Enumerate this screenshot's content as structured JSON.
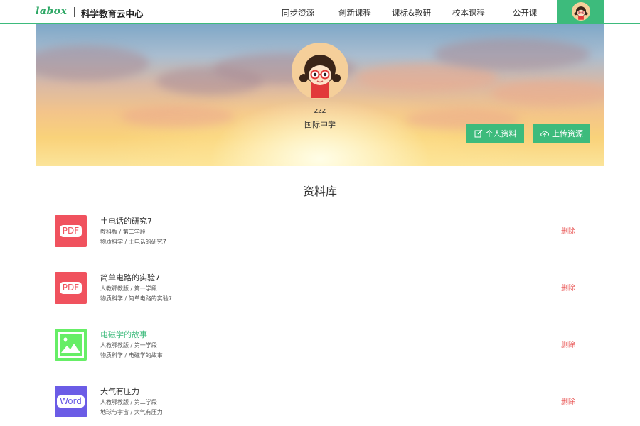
{
  "header": {
    "logo": "labox",
    "title": "科学教育云中心",
    "nav": [
      "同步资源",
      "创新课程",
      "课标&教研",
      "校本课程",
      "公开课"
    ]
  },
  "profile": {
    "name": "zzz",
    "school": "国际中学",
    "profile_button": "个人资料",
    "upload_button": "上传资源"
  },
  "library": {
    "title": "资料库",
    "delete_label": "删除",
    "items": [
      {
        "type": "PDF",
        "title": "土电话的研究7",
        "meta1": "教科版 / 第二学段",
        "meta2": "物质科学 / 土电话的研究7"
      },
      {
        "type": "PDF",
        "title": "简单电路的实验7",
        "meta1": "人教鄂教版 / 第一学段",
        "meta2": "物质科学 / 简单电路的实验7"
      },
      {
        "type": "image",
        "title": "电磁学的故事",
        "meta1": "人教鄂教版 / 第一学段",
        "meta2": "物质科学 / 电磁学的故事"
      },
      {
        "type": "Word",
        "title": "大气有压力",
        "meta1": "人教鄂教版 / 第二学段",
        "meta2": "地球与宇宙 / 大气有压力"
      }
    ]
  },
  "colors": {
    "accent": "#3dbb7c",
    "pdf": "#f0525e",
    "image": "#66ee66",
    "word": "#6b5ce6",
    "delete": "#e8504f"
  }
}
